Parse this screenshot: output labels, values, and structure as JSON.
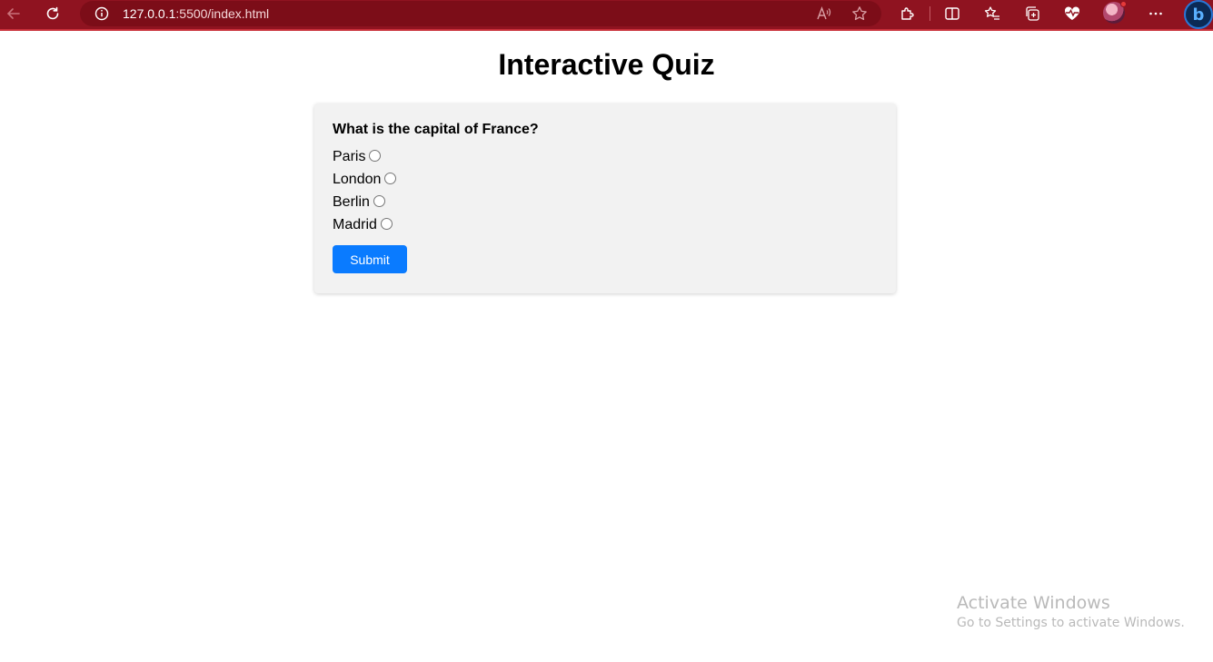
{
  "browser": {
    "url_host": "127.0.0.1",
    "url_rest": ":5500/index.html"
  },
  "page": {
    "title": "Interactive Quiz"
  },
  "quiz": {
    "question": "What is the capital of France?",
    "options": [
      "Paris",
      "London",
      "Berlin",
      "Madrid"
    ],
    "submit_label": "Submit"
  },
  "watermark": {
    "title": "Activate Windows",
    "subtitle": "Go to Settings to activate Windows."
  },
  "colors": {
    "toolbar": "#8f1320",
    "submit_button": "#0a7bff",
    "card_background": "#f2f2f2"
  }
}
